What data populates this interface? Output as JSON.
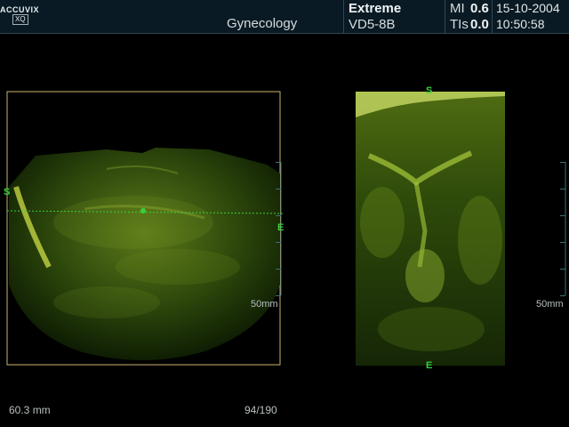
{
  "header": {
    "brand": "ACCUVIX",
    "model_badge": "XQ",
    "preset": "Gynecology",
    "mode": "Extreme",
    "probe": "VD5-8B",
    "mi_label": "MI",
    "mi_value": "0.6",
    "tis_label": "TIs",
    "tis_value": "0.0",
    "date": "15-10-2004",
    "time": "10:50:58"
  },
  "left_view": {
    "depth_label": "50mm",
    "marker_start": "S",
    "marker_end": "E"
  },
  "right_view": {
    "depth_label": "50mm",
    "marker_start": "S",
    "marker_end": "E"
  },
  "footer": {
    "measurement": "60.3 mm",
    "frame_counter": "94/190"
  },
  "colors": {
    "header_bg": "#0a1a24",
    "accent_green": "#35d23a",
    "frame_yellow": "#c9b36a",
    "scale_cyan": "#3e6f78"
  }
}
